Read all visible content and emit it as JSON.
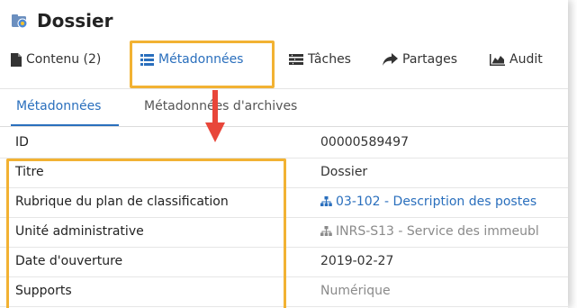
{
  "header": {
    "title": "Dossier",
    "icon": "folder-icon"
  },
  "tabs": [
    {
      "label": "Contenu (2)",
      "icon": "document-icon"
    },
    {
      "label": "Métadonnées",
      "icon": "list-icon",
      "active": true
    },
    {
      "label": "Tâches",
      "icon": "tasks-icon"
    },
    {
      "label": "Partages",
      "icon": "share-arrow-icon"
    },
    {
      "label": "Audit",
      "icon": "area-chart-icon"
    }
  ],
  "subtabs": [
    {
      "label": "Métadonnées",
      "active": true
    },
    {
      "label": "Métadonnées d'archives"
    }
  ],
  "fields": [
    {
      "label": "ID",
      "value": "00000589497"
    },
    {
      "label": "Titre",
      "value": "Dossier"
    },
    {
      "label": "Rubrique du plan de classification",
      "value": "03-102 - Description des postes",
      "icon": "hierarchy-icon"
    },
    {
      "label": "Unité administrative",
      "value": "INRS-S13 - Service des immeubl",
      "icon": "hierarchy-icon"
    },
    {
      "label": "Date d'ouverture",
      "value": "2019-02-27"
    },
    {
      "label": "Supports",
      "value": "Numérique"
    }
  ],
  "colors": {
    "accent": "#2a6fbd",
    "highlight": "#f2b233",
    "arrow": "#e8463a"
  }
}
